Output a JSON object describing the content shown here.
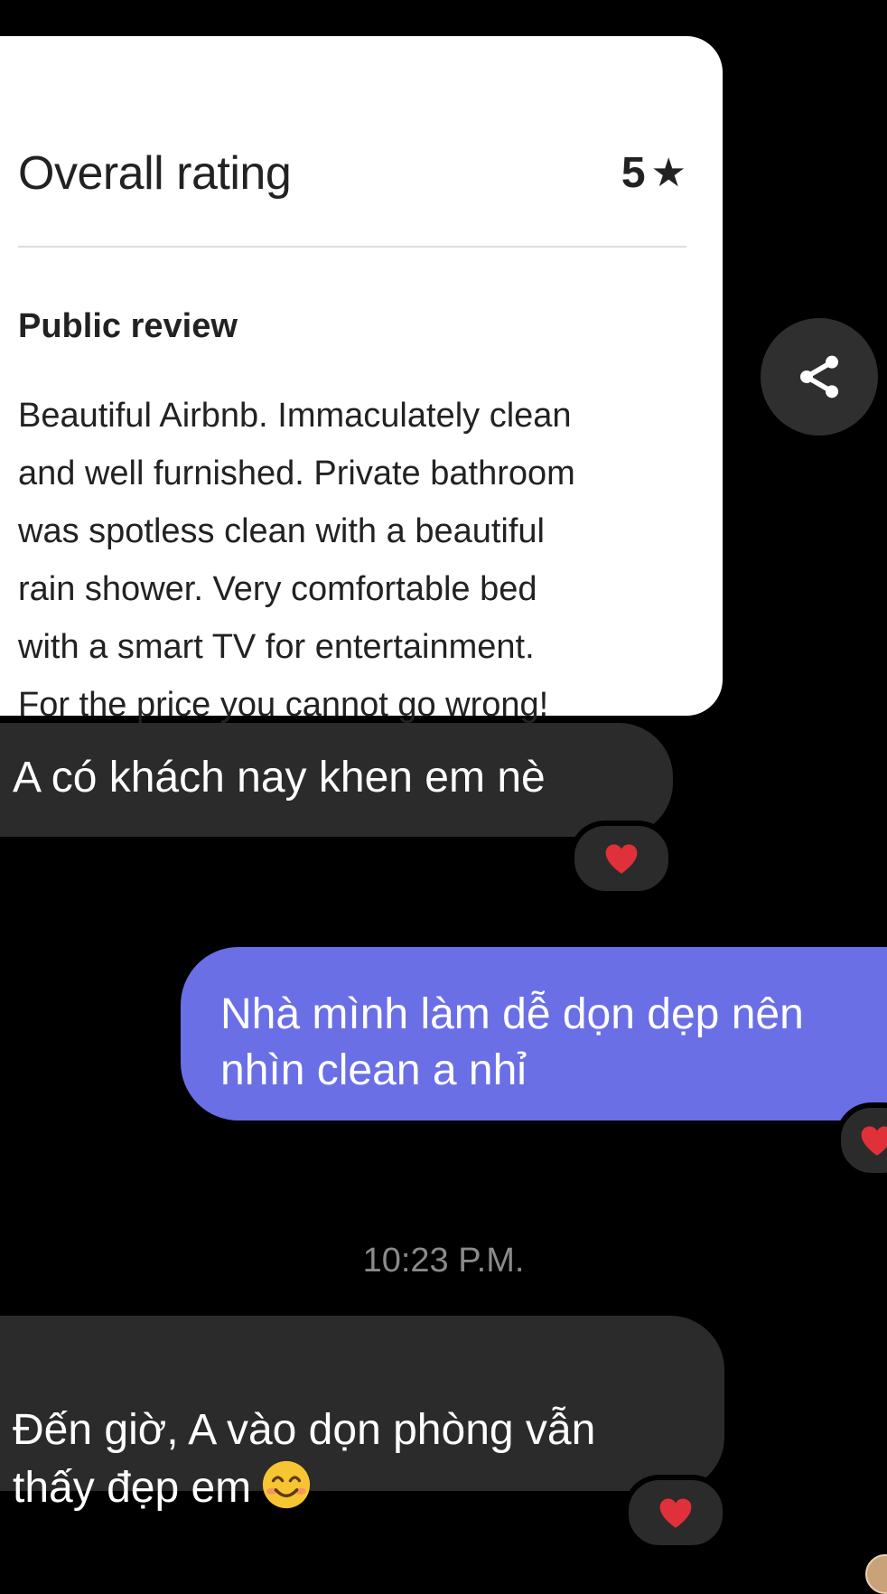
{
  "review_card": {
    "rating_title": "Overall rating",
    "rating_value": "5",
    "review_heading": "Public review",
    "review_text": "Beautiful Airbnb. Immaculately clean\nand well furnished. Private bathroom\nwas spotless clean with a beautiful\nrain shower. Very comfortable bed\nwith a smart TV for entertainment.\nFor the price you cannot go wrong!"
  },
  "messages": [
    {
      "direction": "incoming",
      "text": "A có khách nay khen em nè",
      "reaction": "heart"
    },
    {
      "direction": "outgoing",
      "text": "Nhà mình làm dễ dọn dẹp nên nhìn clean a nhỉ",
      "line1": "Nhà mình làm dễ dọn dẹp nên",
      "line2": "nhìn clean a nhỉ",
      "reaction": "heart"
    },
    {
      "direction": "incoming",
      "text": "Đến giờ, A vào dọn phòng vẫn\nthấy đẹp em",
      "reaction": "heart"
    }
  ],
  "timestamp": "10:23 P.M.",
  "icons": {
    "share": "share-icon",
    "heart": "heart-icon",
    "star": "star-icon",
    "emoji": "smiling-face-emoji"
  },
  "colors": {
    "background": "#000000",
    "incoming_bubble": "#2b2b2b",
    "outgoing_bubble": "#6a6fe6",
    "card": "#ffffff",
    "heart": "#e0303a"
  }
}
